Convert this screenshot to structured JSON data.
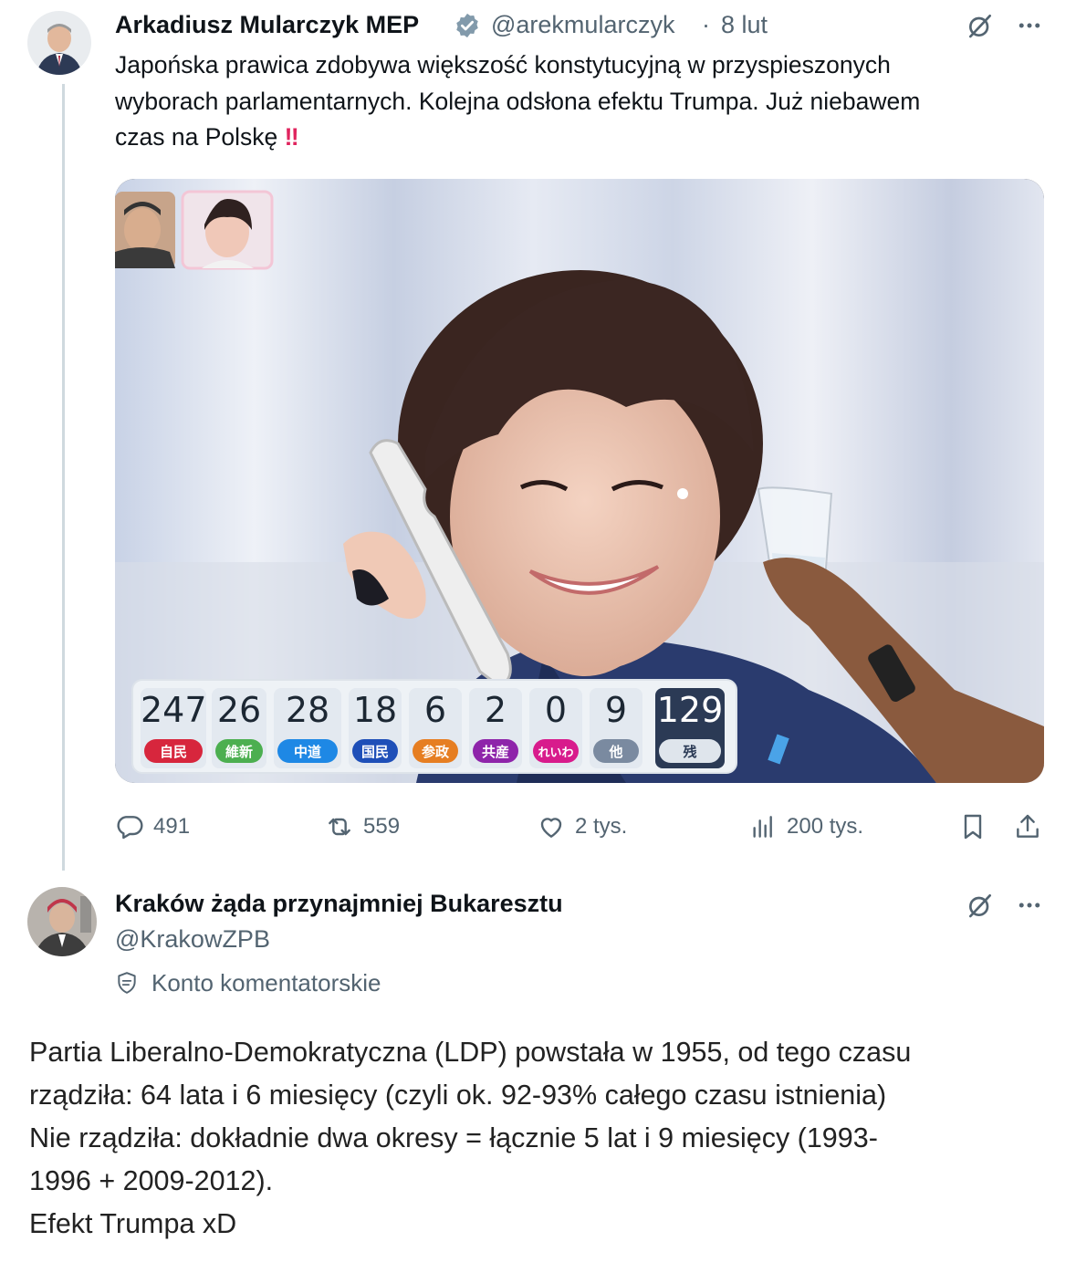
{
  "post": {
    "author_name": "Arkadiusz Mularczyk MEP",
    "handle": "@arekmularczyk",
    "separator": "·",
    "date": "8 lut",
    "text": "Japońska prawica zdobywa większość konstytucyjną w przyspieszonych wyborach parlamentarnych. Kolejna odsłona efektu Trumpa. Już niebawem czas na Polskę",
    "text_lines": [
      "Japońska prawica zdobywa większość konstytucyjną w przyspieszonych",
      "wyborach parlamentarnych. Kolejna odsłona efektu Trumpa. Już niebawem",
      "czas na Polskę"
    ],
    "emoji": "‼",
    "verified_icon": "verified-badge-icon",
    "more_icon": "more-dots-icon",
    "grok_icon": "grok-icon",
    "media": {
      "scoreboard": [
        {
          "value": "247",
          "tag": "自民",
          "color": "#d7263d"
        },
        {
          "value": "26",
          "tag": "維新",
          "color": "#4caf50"
        },
        {
          "value": "28",
          "tag": "中道",
          "color": "#1e88e5"
        },
        {
          "value": "18",
          "tag": "国民",
          "color": "#1e4fb8"
        },
        {
          "value": "6",
          "tag": "参政",
          "color": "#e67e22"
        },
        {
          "value": "2",
          "tag": "共産",
          "color": "#8e24aa"
        },
        {
          "value": "0",
          "tag": "れいわ",
          "color": "#d81b8c"
        },
        {
          "value": "9",
          "tag": "他",
          "color": "#7a8aa0"
        },
        {
          "value": "129",
          "tag": "残",
          "color": "#dfe5ec"
        }
      ]
    },
    "actions": {
      "replies": "491",
      "reposts": "559",
      "likes": "2 tys.",
      "views": "200 tys."
    }
  },
  "reply": {
    "author_name": "Kraków żąda przynajmniej Bukaresztu",
    "handle": "@KrakowZPB",
    "account_label": "Konto komentatorskie",
    "text_lines": [
      "Partia Liberalno-Demokratyczna (LDP) powstała w 1955, od tego czasu",
      "rządziła: 64 lata i 6 miesięcy (czyli ok. 92-93% całego czasu istnienia)",
      "Nie rządziła: dokładnie dwa okresy = łącznie 5 lat i 9 miesięcy (1993-",
      "1996 + 2009-2012).",
      "Efekt Trumpa xD"
    ]
  },
  "colors": {
    "text": "#0f1419",
    "muted": "#536471",
    "verified": "#829aab",
    "thread_line": "#cfd9de"
  }
}
